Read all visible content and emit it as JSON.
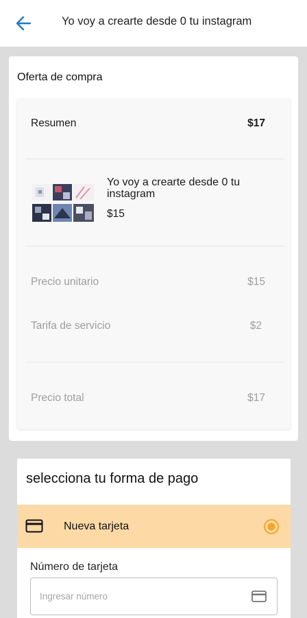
{
  "header": {
    "title": "Yo voy a crearte desde 0 tu instagram",
    "back_icon": "arrow-left-icon"
  },
  "offer": {
    "title": "Oferta de compra",
    "summary_label": "Resumen",
    "summary_total": "$17",
    "product": {
      "title": "Yo voy a crearte desde 0 tu instagram",
      "price": "$15"
    },
    "unit_price_label": "Precio unitario",
    "unit_price_value": "$15",
    "service_fee_label": "Tarifa de servicio",
    "service_fee_value": "$2",
    "total_label": "Precio total",
    "total_value": "$17"
  },
  "payment": {
    "title": "selecciona tu forma de pago",
    "option_label": "Nueva tarjeta",
    "option_selected": true,
    "card_number_label": "Número de tarjeta",
    "card_number_placeholder": "Ingresar número",
    "card_number_value": ""
  },
  "colors": {
    "accent": "#1f7ac4",
    "selected_option_bg": "#fdd9a6",
    "radio": "#f5a623"
  }
}
